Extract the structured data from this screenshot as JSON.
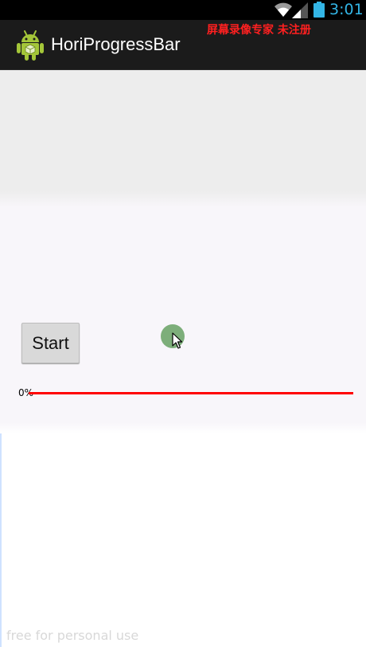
{
  "status_bar": {
    "time": "3:01",
    "icons": [
      "wifi-icon",
      "signal-icon",
      "battery-icon"
    ],
    "time_color": "#33b5e5"
  },
  "action_bar": {
    "title": "HoriProgressBar",
    "icon": "android-icon",
    "background": "#1b1b1b"
  },
  "watermarks": {
    "top": "屏幕录像专家  未注册",
    "bottom": "free for personal use",
    "top_color": "#ff2020"
  },
  "main": {
    "start_button_label": "Start",
    "progress": {
      "label": "0%",
      "value": 0,
      "max": 100,
      "track_color": "#ff0000"
    }
  }
}
